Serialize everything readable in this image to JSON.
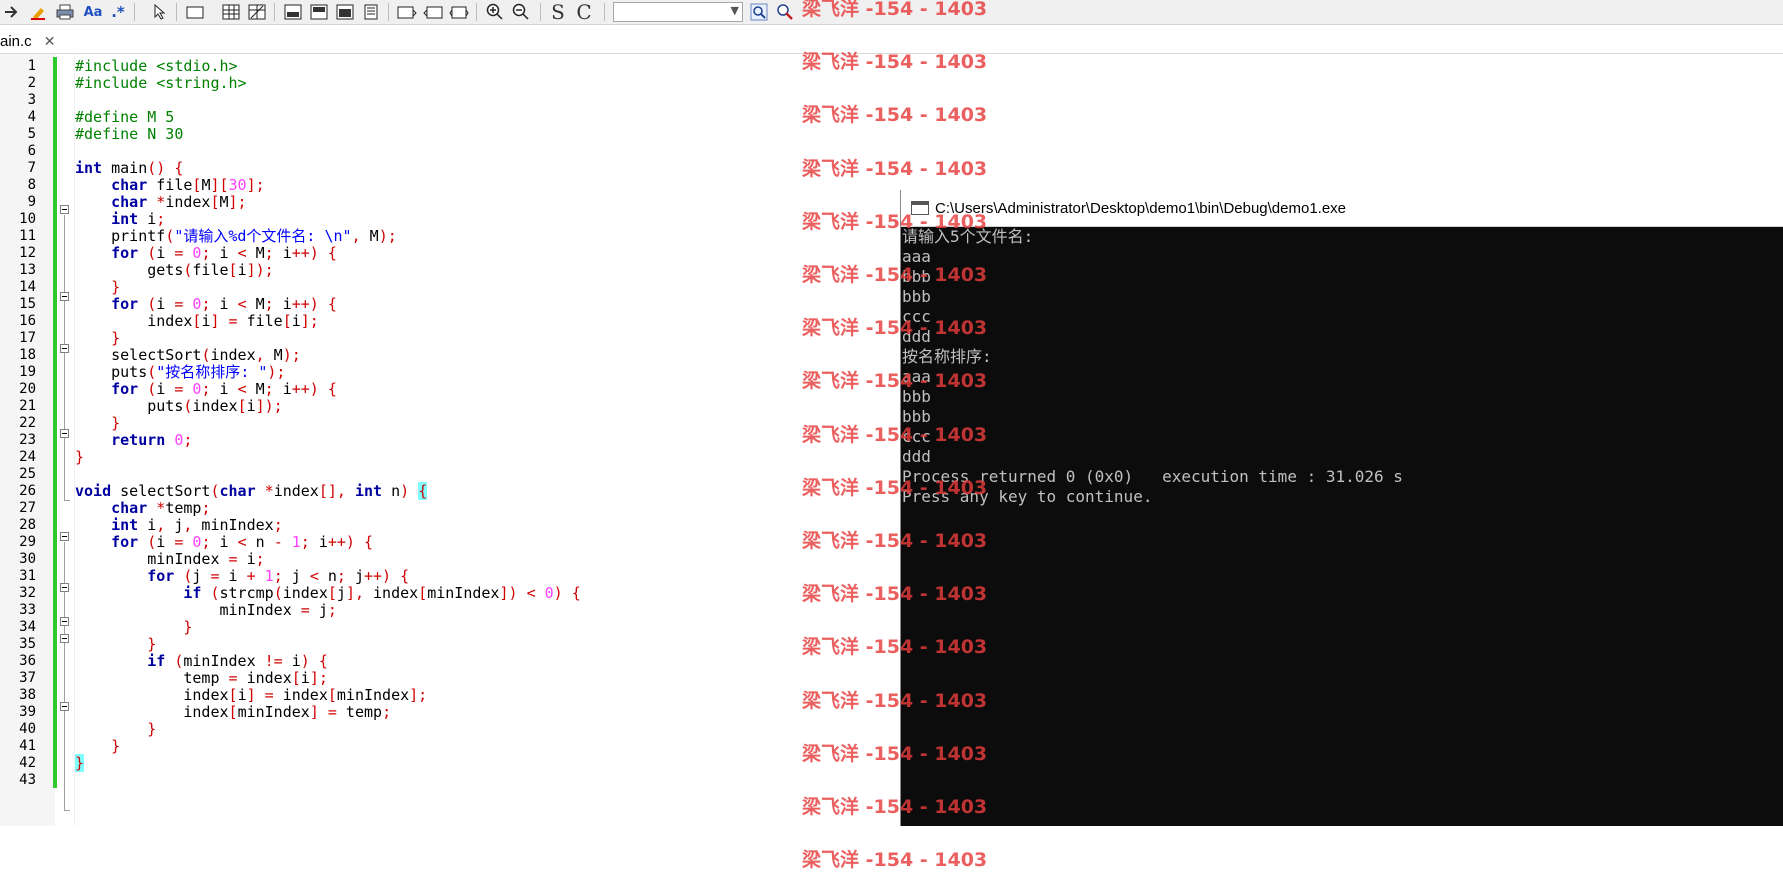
{
  "tab": {
    "label": "ain.c",
    "close": "✕"
  },
  "toolbar": {
    "search_value": "",
    "icons": [
      "arrow-right-icon",
      "highlight-icon",
      "print-icon",
      "match-case-icon",
      "regex-icon",
      "pointer-icon",
      "rectangle-icon",
      "grid-icon",
      "table-icon",
      "layout-icon",
      "layout2-icon",
      "layout3-icon",
      "layout4-icon",
      "window-icon",
      "window2-icon",
      "window3-icon",
      "zoom-in-icon",
      "zoom-out-icon",
      "S",
      "C",
      "find-icon",
      "find-replace-icon"
    ],
    "labels": {
      "match_case": "Aa",
      "regex": ".*",
      "s": "S",
      "c": "C"
    }
  },
  "editor": {
    "line_numbers": [
      "1",
      "2",
      "3",
      "4",
      "5",
      "6",
      "7",
      "8",
      "9",
      "10",
      "11",
      "12",
      "13",
      "14",
      "15",
      "16",
      "17",
      "18",
      "19",
      "20",
      "21",
      "22",
      "23",
      "24",
      "25",
      "26",
      "27",
      "28",
      "29",
      "30",
      "31",
      "32",
      "33",
      "34",
      "35",
      "36",
      "37",
      "38",
      "39",
      "40",
      "41",
      "42",
      "43"
    ]
  },
  "console": {
    "title": "C:\\Users\\Administrator\\Desktop\\demo1\\bin\\Debug\\demo1.exe",
    "lines": [
      "请输入5个文件名:",
      "aaa",
      "bbb",
      "bbb",
      "ccc",
      "ddd",
      "按名称排序:",
      "aaa",
      "bbb",
      "bbb",
      "ccc",
      "ddd",
      "",
      "Process returned 0 (0x0)   execution time : 31.026 s",
      "Press any key to continue."
    ]
  },
  "watermark": {
    "text": "梁飞洋 -154 - 1403"
  }
}
